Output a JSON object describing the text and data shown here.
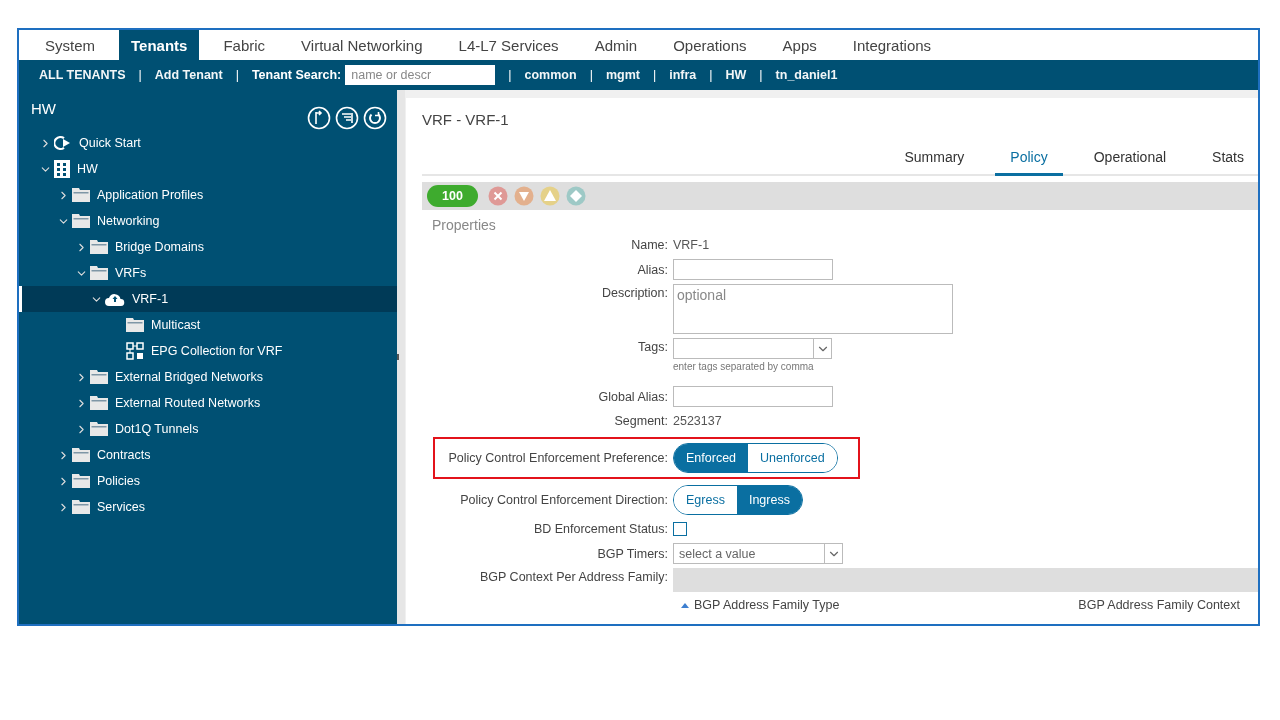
{
  "top_tabs": [
    {
      "label": "System",
      "selected": false
    },
    {
      "label": "Tenants",
      "selected": true
    },
    {
      "label": "Fabric",
      "selected": false
    },
    {
      "label": "Virtual Networking",
      "selected": false
    },
    {
      "label": "L4-L7 Services",
      "selected": false
    },
    {
      "label": "Admin",
      "selected": false
    },
    {
      "label": "Operations",
      "selected": false
    },
    {
      "label": "Apps",
      "selected": false
    },
    {
      "label": "Integrations",
      "selected": false
    }
  ],
  "tenant_bar": [
    {
      "kind": "link",
      "label": "ALL TENANTS"
    },
    {
      "kind": "separator",
      "label": "|"
    },
    {
      "kind": "link",
      "label": "Add Tenant"
    },
    {
      "kind": "separator",
      "label": "|"
    },
    {
      "kind": "label",
      "label": "Tenant Search:"
    },
    {
      "kind": "search",
      "placeholder": "name or descr"
    },
    {
      "kind": "separator",
      "label": "|"
    },
    {
      "kind": "link",
      "label": "common"
    },
    {
      "kind": "separator",
      "label": "|"
    },
    {
      "kind": "link",
      "label": "mgmt"
    },
    {
      "kind": "separator",
      "label": "|"
    },
    {
      "kind": "link",
      "label": "infra"
    },
    {
      "kind": "separator",
      "label": "|"
    },
    {
      "kind": "link",
      "label": "HW"
    },
    {
      "kind": "separator",
      "label": "|"
    },
    {
      "kind": "link",
      "label": "tn_daniel1"
    }
  ],
  "sidebar": {
    "title": "HW",
    "tree": [
      {
        "label": "Quick Start",
        "kind": "quickstart",
        "expanded": false,
        "selected": false
      },
      {
        "label": "HW",
        "kind": "tenant",
        "expanded": true,
        "selected": false,
        "children": [
          {
            "label": "Application Profiles",
            "kind": "folder",
            "expanded": false,
            "selected": false
          },
          {
            "label": "Networking",
            "kind": "folder",
            "expanded": true,
            "selected": false,
            "children": [
              {
                "label": "Bridge Domains",
                "kind": "folder",
                "expanded": false,
                "selected": false
              },
              {
                "label": "VRFs",
                "kind": "folder",
                "expanded": true,
                "selected": false,
                "children": [
                  {
                    "label": "VRF-1",
                    "kind": "vrf",
                    "expanded": true,
                    "selected": true,
                    "children": [
                      {
                        "label": "Multicast",
                        "kind": "folder",
                        "selected": false
                      },
                      {
                        "label": "EPG Collection for VRF",
                        "kind": "epg",
                        "selected": false
                      }
                    ]
                  }
                ]
              },
              {
                "label": "External Bridged Networks",
                "kind": "folder",
                "expanded": false,
                "selected": false
              },
              {
                "label": "External Routed Networks",
                "kind": "folder",
                "expanded": false,
                "selected": false
              },
              {
                "label": "Dot1Q Tunnels",
                "kind": "folder",
                "expanded": false,
                "selected": false
              }
            ]
          },
          {
            "label": "Contracts",
            "kind": "folder",
            "expanded": false,
            "selected": false
          },
          {
            "label": "Policies",
            "kind": "folder",
            "expanded": false,
            "selected": false
          },
          {
            "label": "Services",
            "kind": "folder",
            "expanded": false,
            "selected": false
          }
        ]
      }
    ]
  },
  "content": {
    "title": "VRF - VRF-1",
    "tabs": [
      {
        "label": "Summary",
        "selected": false
      },
      {
        "label": "Policy",
        "selected": true
      },
      {
        "label": "Operational",
        "selected": false
      },
      {
        "label": "Stats",
        "selected": false
      }
    ],
    "health_score": "100",
    "section": "Properties",
    "fields": [
      {
        "kind": "text",
        "label": "Name:",
        "value": "VRF-1",
        "highlighted": false
      },
      {
        "kind": "input",
        "label": "Alias:",
        "highlighted": false
      },
      {
        "kind": "textarea",
        "label": "Description:",
        "placeholder": "optional",
        "highlighted": false
      },
      {
        "kind": "tags",
        "label": "Tags:",
        "hint": "enter tags separated by comma",
        "highlighted": false
      },
      {
        "kind": "input",
        "label": "Global Alias:",
        "highlighted": false
      },
      {
        "kind": "text",
        "label": "Segment:",
        "value": "2523137",
        "highlighted": false
      },
      {
        "kind": "segmented",
        "label": "Policy Control Enforcement Preference:",
        "highlighted": true,
        "options": [
          {
            "label": "Enforced",
            "selected": true
          },
          {
            "label": "Unenforced",
            "selected": false
          }
        ]
      },
      {
        "kind": "segmented",
        "label": "Policy Control Enforcement Direction:",
        "highlighted": false,
        "options": [
          {
            "label": "Egress",
            "selected": false
          },
          {
            "label": "Ingress",
            "selected": true
          }
        ]
      },
      {
        "kind": "checkbox",
        "label": "BD Enforcement Status:",
        "checked": false,
        "highlighted": false
      },
      {
        "kind": "select",
        "label": "BGP Timers:",
        "placeholder": "select a value",
        "highlighted": false
      },
      {
        "kind": "table",
        "label": "BGP Context Per Address Family:",
        "highlighted": false,
        "columns": [
          {
            "label": "BGP Address Family Type",
            "sorted": true
          },
          {
            "label": "BGP Address Family Context",
            "sorted": false
          }
        ]
      }
    ]
  }
}
